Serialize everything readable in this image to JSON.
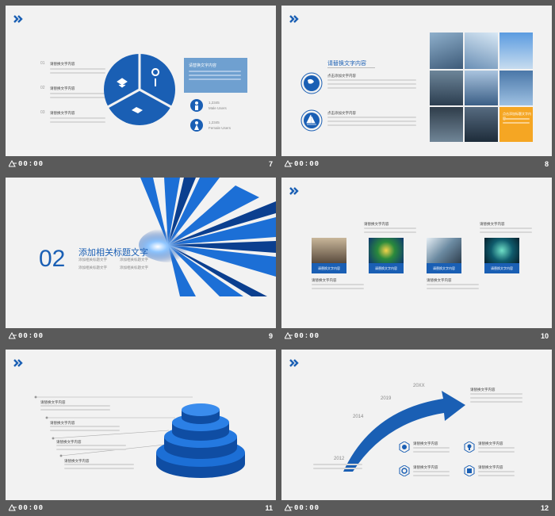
{
  "colors": {
    "accent": "#1a5fb4",
    "orange": "#f5a623",
    "panel_light": "#6fa0d0"
  },
  "slides": [
    {
      "time": "00:00",
      "number": "7",
      "items": [
        {
          "num": "01",
          "title": "请替换文字内容"
        },
        {
          "num": "02",
          "title": "请替换文字内容"
        },
        {
          "num": "03",
          "title": "请替换文字内容"
        }
      ],
      "panel_title": "请替换文字内容",
      "stats": [
        {
          "value": "1,2345",
          "label": "Male Users"
        },
        {
          "value": "1,2345",
          "label": "Female Users"
        }
      ]
    },
    {
      "time": "00:00",
      "number": "8",
      "heading": "请替换文字内容",
      "items": [
        {
          "title": "点击添加文字内容"
        },
        {
          "title": "点击添加文字内容"
        }
      ],
      "orange_box": "点击添加标题文字内容"
    },
    {
      "time": "00:00",
      "number": "9",
      "section_num": "02",
      "section_title": "添加相关标题文字",
      "bullets": [
        "添加相关标题文字",
        "添加相关标题文字",
        "添加相关标题文字",
        "添加相关标题文字"
      ]
    },
    {
      "time": "00:00",
      "number": "10",
      "top_titles": [
        "请替换文字内容",
        "请替换文字内容"
      ],
      "photo_labels": [
        "请替换文字内容",
        "请替换文字内容",
        "请替换文字内容",
        "请替换文字内容"
      ],
      "bottom_titles": [
        "请替换文字内容",
        "请替换文字内容"
      ]
    },
    {
      "time": "00:00",
      "number": "11",
      "labels": [
        "请替换文字内容",
        "请替换文字内容",
        "请替换文字内容",
        "请替换文字内容"
      ]
    },
    {
      "time": "00:00",
      "number": "12",
      "years": [
        "2012",
        "2014",
        "2019",
        "20XX"
      ],
      "top_title": "请替换文字内容",
      "grid_titles": [
        "请替换文字内容",
        "请替换文字内容",
        "请替换文字内容",
        "请替换文字内容"
      ]
    }
  ]
}
